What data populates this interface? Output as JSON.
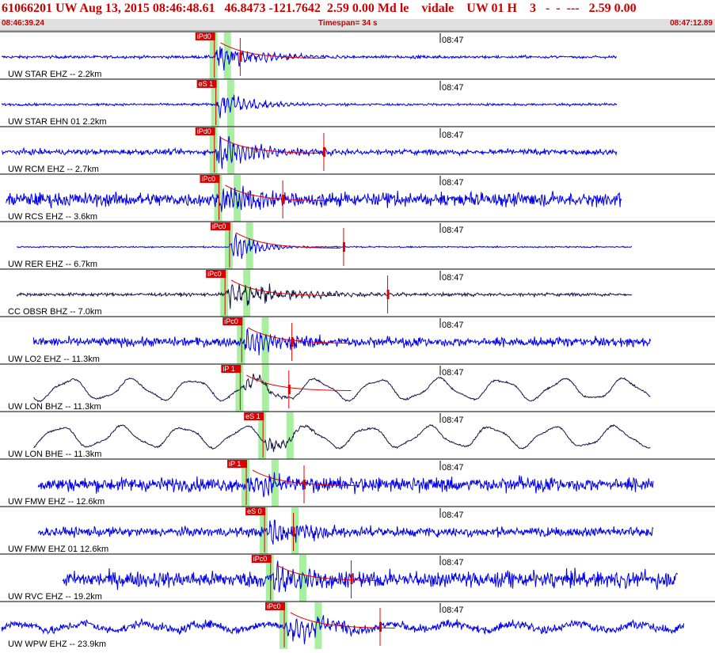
{
  "header": {
    "title": "61066201 UW Aug 13, 2015 08:46:48.61   46.8473 -121.7642  2.59 0.00 Md le    vidale    UW 01 H    3   -  -  ---   2.59 0.00",
    "start_time": "08:46:39.24",
    "timespan": "Timespan=  34 s",
    "end_time": "08:47:12.89"
  },
  "colors": {
    "trace_blue": "#0000ee",
    "trace_black": "#141446",
    "pick_red": "#dd0000",
    "window_green": "#a8f0a0",
    "title_red": "#cc0000"
  },
  "chart_data": {
    "type": "line",
    "title": "",
    "time_marker": "08:47",
    "x_range": [
      "08:46:39.24",
      "08:47:12.89"
    ],
    "timespan_s": 34,
    "traces": [
      {
        "label": "UW STAR EHZ -- 2.2km",
        "pick": "iPd0",
        "color": "blue",
        "onset_s": 14.1,
        "end_s": 40.6,
        "start_s": 0.0,
        "noise": 0.06,
        "amp": 0.75,
        "decay": 2.5,
        "period": 0.35,
        "lp": 0,
        "red_marks": [
          15.8
        ],
        "curve": true
      },
      {
        "label": "UW STAR EHN 01 2.2km",
        "pick": "eS 1",
        "color": "blue",
        "onset_s": 14.2,
        "end_s": 40.6,
        "start_s": 0.0,
        "noise": 0.05,
        "amp": 0.7,
        "decay": 2.2,
        "period": 0.35,
        "lp": 0,
        "red_marks": [],
        "curve": false
      },
      {
        "label": "UW RCM EHZ -- 2.7km",
        "pick": "iPd0",
        "color": "blue",
        "onset_s": 14.1,
        "end_s": 40.6,
        "start_s": 0.0,
        "noise": 0.12,
        "amp": 0.8,
        "decay": 3.0,
        "period": 0.3,
        "lp": 0,
        "red_marks": [
          21.3
        ],
        "curve": true
      },
      {
        "label": "UW RCS EHZ -- 3.6km",
        "pick": "iPc0",
        "color": "blue",
        "onset_s": 14.4,
        "end_s": 40.9,
        "start_s": 0.3,
        "noise": 0.3,
        "amp": 0.65,
        "decay": 3.5,
        "period": 0.25,
        "lp": 0,
        "red_marks": [
          18.6
        ],
        "curve": true
      },
      {
        "label": "UW RER EHZ -- 6.7km",
        "pick": "iPc0",
        "color": "blue",
        "onset_s": 15.1,
        "end_s": 41.6,
        "start_s": 1.0,
        "noise": 0.03,
        "amp": 0.85,
        "decay": 1.5,
        "period": 0.3,
        "lp": 0,
        "red_marks": [
          22.6
        ],
        "curve": true
      },
      {
        "label": "CC OBSR BHZ -- 7.0km",
        "pick": "iPc0",
        "color": "black",
        "onset_s": 14.8,
        "end_s": 41.6,
        "start_s": 1.0,
        "noise": 0.07,
        "amp": 0.6,
        "decay": 4.0,
        "period": 0.4,
        "lp": 0,
        "red_marks": [
          25.5
        ],
        "curve": true
      },
      {
        "label": "UW LO2 EHZ -- 11.3km",
        "pick": "iPc0",
        "color": "blue",
        "onset_s": 15.9,
        "end_s": 42.8,
        "start_s": 2.1,
        "noise": 0.2,
        "amp": 0.6,
        "decay": 3.0,
        "period": 0.3,
        "lp": 0,
        "red_marks": [
          19.2
        ],
        "curve": true
      },
      {
        "label": "UW LON BHZ -- 11.3km",
        "pick": "iP 1",
        "color": "black",
        "onset_s": 15.8,
        "end_s": 42.8,
        "start_s": 2.1,
        "noise": 0.04,
        "amp": 0.4,
        "decay": 1.5,
        "period": 0.4,
        "lp": 0.45,
        "red_marks": [
          19.0
        ],
        "curve": true
      },
      {
        "label": "UW LON BHE -- 11.3km",
        "pick": "eS 1",
        "color": "black",
        "onset_s": 17.3,
        "end_s": 42.8,
        "start_s": 2.1,
        "noise": 0.04,
        "amp": 0.45,
        "decay": 1.5,
        "period": 0.4,
        "lp": 0.45,
        "red_marks": [],
        "curve": false
      },
      {
        "label": "UW FMW EHZ -- 12.6km",
        "pick": "iP 1",
        "color": "blue",
        "onset_s": 16.2,
        "end_s": 43.0,
        "start_s": 2.4,
        "noise": 0.3,
        "amp": 0.7,
        "decay": 3.0,
        "period": 0.3,
        "lp": 0,
        "red_marks": [
          20.0
        ],
        "curve": true
      },
      {
        "label": "UW FMW EHZ 01 12.6km",
        "pick": "eS 0",
        "color": "blue",
        "onset_s": 17.4,
        "end_s": 43.0,
        "start_s": 2.4,
        "noise": 0.2,
        "amp": 0.75,
        "decay": 3.0,
        "period": 0.3,
        "lp": 0,
        "red_marks": [
          19.3
        ],
        "curve": false
      },
      {
        "label": "UW RVC EHZ -- 19.2km",
        "pick": "iPc0",
        "color": "blue",
        "onset_s": 17.8,
        "end_s": 44.6,
        "start_s": 4.0,
        "noise": 0.35,
        "amp": 0.75,
        "decay": 3.0,
        "period": 0.35,
        "lp": 0,
        "red_marks": [
          23.1
        ],
        "curve": true
      },
      {
        "label": "UW WPW EHZ -- 23.9km",
        "pick": "iPc0",
        "color": "blue",
        "onset_s": 18.7,
        "end_s": 45.0,
        "start_s": 0.0,
        "noise": 0.18,
        "amp": 0.7,
        "decay": 3.0,
        "period": 0.35,
        "lp": 0.15,
        "red_marks": [
          25.0
        ],
        "curve": true
      }
    ]
  }
}
